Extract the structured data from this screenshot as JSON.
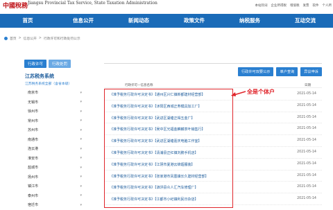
{
  "header": {
    "logo": "中國稅務",
    "site_en": "Jiangsu Provincial Tax Service, State Taxation Administration",
    "toplinks": [
      "本站热词",
      "企业所得税",
      "增值税",
      "发票",
      "软件",
      "个人所"
    ]
  },
  "nav": [
    "首页",
    "信息公开",
    "新闻动态",
    "政策文件",
    "纳税服务",
    "互动交流"
  ],
  "breadcrumb": [
    "首页",
    "信息公开",
    "行政许可和行政处罚公示"
  ],
  "sidebar": {
    "tabs": [
      "行政许可",
      "行政处罚"
    ],
    "title": "江苏税务系统",
    "subtitle": "江苏税务系统全部（含省本级）",
    "items": [
      "南京市",
      "无锡市",
      "徐州市",
      "常州市",
      "苏州市",
      "南通市",
      "连云港",
      "淮安市",
      "盐城市",
      "扬州市",
      "镇江市",
      "泰州市",
      "宿迁市"
    ]
  },
  "main": {
    "buttons": [
      "行政许可双要公示",
      "单户查询",
      "异议申诉"
    ],
    "col_title": "行政许可—信息名称",
    "col_date": "日期",
    "rows": [
      {
        "title": "《准予税务行政许可决定书》【通州区兴仁镇新都建材经营部】",
        "date": "2021-05-14"
      },
      {
        "title": "《准予税务行政许可决定书》【沭阳区西城正寿模具加工厂】",
        "date": "2021-05-14"
      },
      {
        "title": "《准予税务行政许可决定书》【武进区湖塘正得五金厂】",
        "date": "2021-05-14"
      },
      {
        "title": "《准予税务行政许可决定书》【吴中区光福金麒麟茶叶销售行】",
        "date": "2021-05-14"
      },
      {
        "title": "《准予税务行政许可决定书》【武进区湖塘嘉庆电脑工作室】",
        "date": "2021-05-14"
      },
      {
        "title": "《准予税务行政许可决定书》【清浦县正红镇刘鹏手机店】",
        "date": "2021-05-14"
      },
      {
        "title": "《准予税务行政许可决定书》【江阴市夏港云锦烟服装】",
        "date": "2021-05-14"
      },
      {
        "title": "《准予税务行政许可决定书》【张家港市凤凰镇长久建材经营部】",
        "date": "2021-05-14"
      },
      {
        "title": "《准予税务行政许可决定书》【泗洪县众人汇汽车修理厂】",
        "date": "2021-05-14"
      },
      {
        "title": "《准予税务行政许可决定书》【江都市小纪镇利民日杂店】",
        "date": "2021-05-14"
      }
    ]
  },
  "annotation": "全是个体户",
  "colors": {
    "accent": "#1a6bb8",
    "button": "#2a7fd0",
    "annotation": "#e0252b"
  }
}
